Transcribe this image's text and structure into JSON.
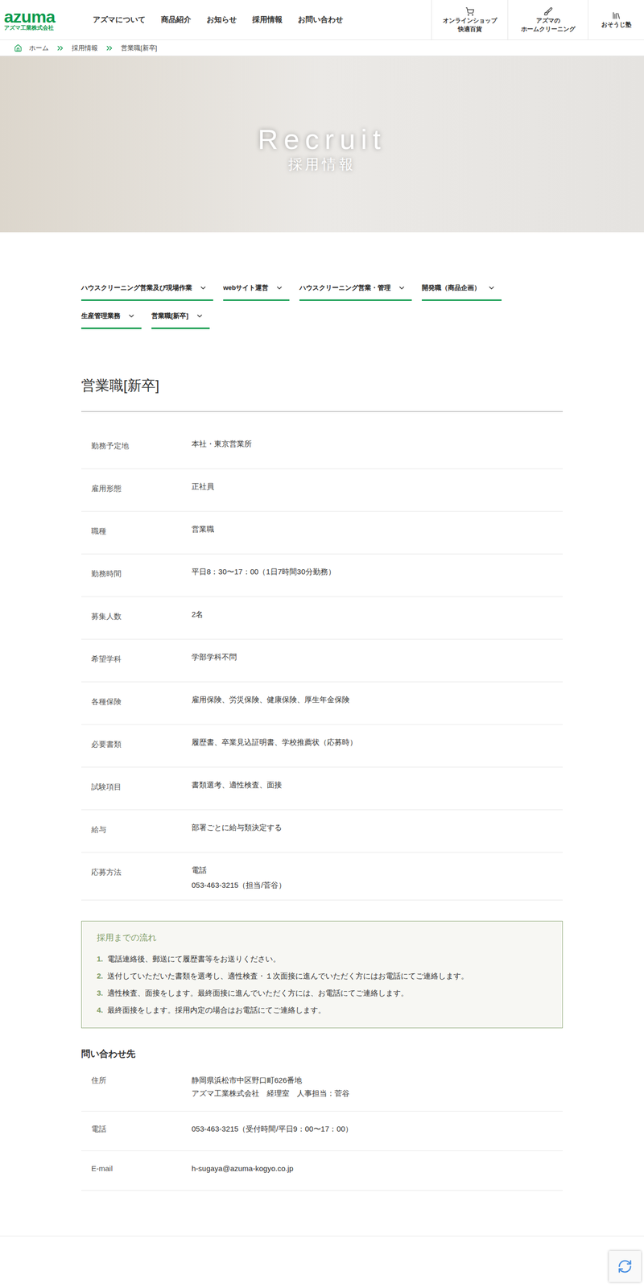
{
  "header": {
    "logo": {
      "mark": "azuma",
      "sub": "アズマ工業株式会社"
    },
    "nav": [
      "アズマについて",
      "商品紹介",
      "お知らせ",
      "採用情報",
      "お問い合わせ"
    ],
    "shortcuts": [
      {
        "lines": [
          "オンラインショップ",
          "快適百貨"
        ],
        "kind": "cart"
      },
      {
        "lines": [
          "アズマの",
          "ホームクリーニング"
        ],
        "kind": "brush"
      },
      {
        "lines": [
          "おそうじ塾"
        ],
        "kind": "books"
      }
    ]
  },
  "breadcrumb": [
    "ホーム",
    "採用情報",
    "営業職[新卒]"
  ],
  "hero": {
    "title": "Recruit",
    "subtitle": "採用情報"
  },
  "tabs": [
    {
      "label": "ハウスクリーニング営業及び現場作業",
      "expanded": false
    },
    {
      "label": "webサイト運営",
      "expanded": false
    },
    {
      "label": "ハウスクリーニング営業・管理",
      "expanded": false
    },
    {
      "label": "開発職（商品企画）",
      "expanded": false
    },
    {
      "label": "生産管理業務",
      "expanded": false
    },
    {
      "label": "営業職[新卒]",
      "expanded": false
    }
  ],
  "job": {
    "title": "営業職[新卒]",
    "rows": [
      {
        "label": "勤務予定地",
        "values": [
          "本社・東京営業所"
        ]
      },
      {
        "label": "雇用形態",
        "values": [
          "正社員"
        ]
      },
      {
        "label": "職種",
        "values": [
          "営業職"
        ]
      },
      {
        "label": "勤務時間",
        "values": [
          "平日8：30〜17：00（1日7時間30分勤務）"
        ]
      },
      {
        "label": "募集人数",
        "values": [
          "2名"
        ]
      },
      {
        "label": "希望学科",
        "values": [
          "学部学科不問"
        ]
      },
      {
        "label": "各種保険",
        "values": [
          "雇用保険、労災保険、健康保険、厚生年金保険"
        ]
      },
      {
        "label": "必要書類",
        "values": [
          "履歴書、卒業見込証明書、学校推薦状（応募時）"
        ]
      },
      {
        "label": "試験項目",
        "values": [
          "書類選考、適性検査、面接"
        ]
      },
      {
        "label": "給与",
        "values": [
          "部署ごとに給与類決定する"
        ]
      },
      {
        "label": "応募方法",
        "values": [
          "電話",
          "053-463-3215（担当/菅谷）"
        ]
      }
    ]
  },
  "flow": {
    "title": "採用までの流れ",
    "steps": [
      {
        "number": "1.",
        "text": "電話連絡後、郵送にて履歴書等をお送りください。"
      },
      {
        "number": "2.",
        "text": "送付していただいた書類を選考し、適性検査・１次面接に進んでいただく方にはお電話にてご連絡します。"
      },
      {
        "number": "3.",
        "text": "適性検査、面接をします。最終面接に進んでいただく方には、お電話にてご連絡します。"
      },
      {
        "number": "4.",
        "text": "最終面接をします。採用内定の場合はお電話にてご連絡します。"
      }
    ]
  },
  "contact": {
    "title": "問い合わせ先",
    "rows": [
      {
        "label": "住所",
        "values": [
          "静岡県浜松市中区野口町626番地",
          "アズマ工業株式会社　経理室　人事担当：菅谷"
        ]
      },
      {
        "label": "電話",
        "values": [
          "053-463-3215（受付時間/平日9：00〜17：00）"
        ]
      },
      {
        "label": "E-mail",
        "values": [
          "h-sugaya@azuma-kogyo.co.jp"
        ]
      }
    ]
  }
}
